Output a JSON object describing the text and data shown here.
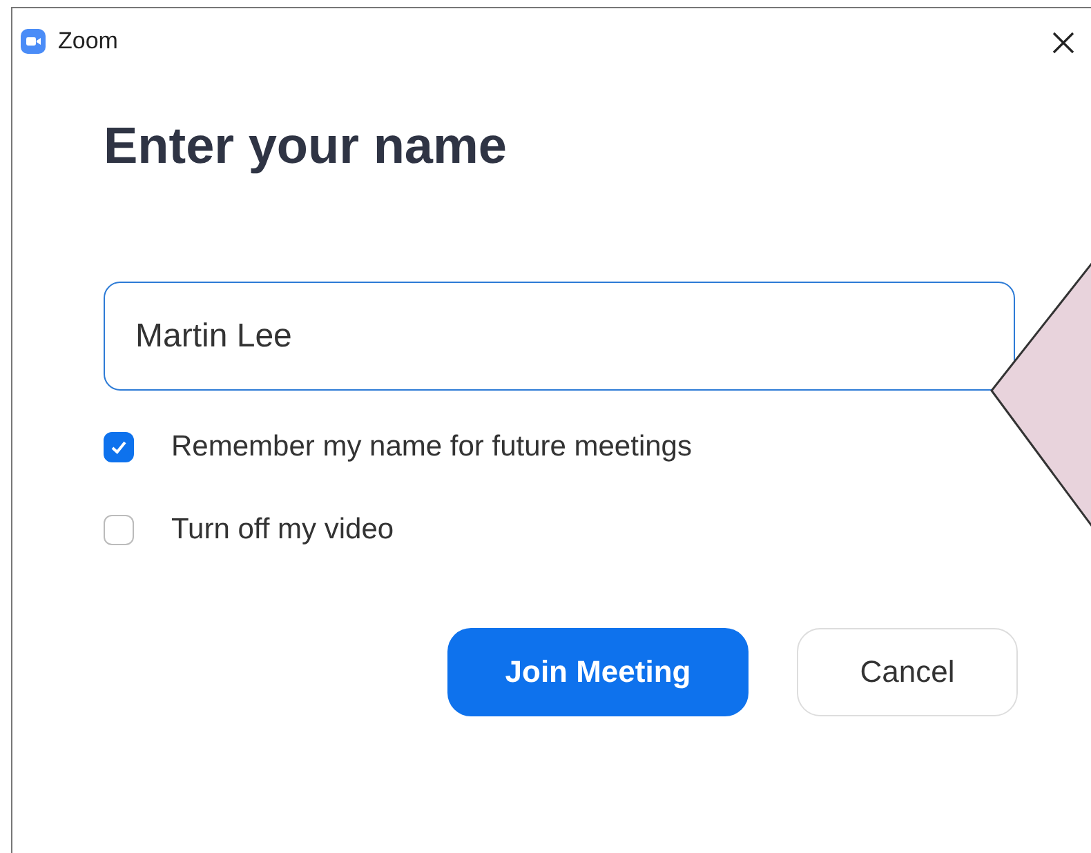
{
  "window": {
    "title": "Zoom"
  },
  "heading": "Enter your name",
  "name_field": {
    "value": "Martin Lee"
  },
  "options": [
    {
      "label": "Remember my name for future meetings",
      "checked": true
    },
    {
      "label": "Turn off my video",
      "checked": false
    }
  ],
  "buttons": [
    {
      "label": "Join Meeting",
      "kind": "primary"
    },
    {
      "label": "Cancel",
      "kind": "secondary"
    }
  ]
}
